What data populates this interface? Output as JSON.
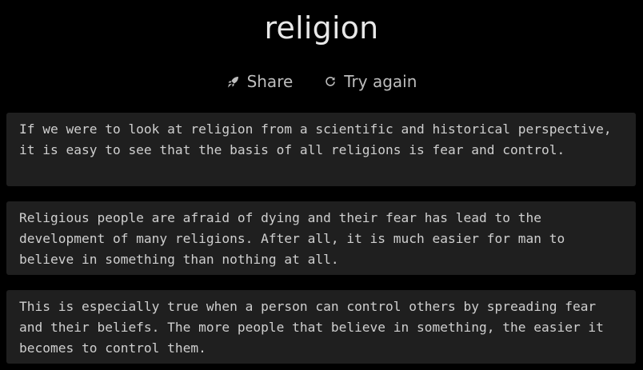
{
  "header": {
    "title": "religion"
  },
  "actions": {
    "share_label": "Share",
    "share_icon": "rocket-icon",
    "try_again_label": "Try again",
    "try_again_icon": "refresh-icon"
  },
  "paragraphs": [
    "If we were to look at religion from a scientific and historical perspective, it is easy to see that the basis of all religions is fear and control.",
    "Religious people are afraid of dying and their fear has lead to the development of many religions. After all, it is much easier for man to believe in something than nothing at all.",
    "This is especially true when a person can control others by spreading fear and their beliefs. The more people that believe in something, the easier it becomes to control them."
  ],
  "colors": {
    "background": "#000000",
    "card_background": "#1f1f1f",
    "text": "#cfcfcf",
    "title_text": "#e8e8e8"
  }
}
